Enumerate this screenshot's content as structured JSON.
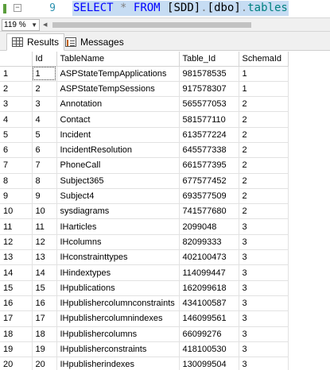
{
  "editor": {
    "line_number": "9",
    "code": {
      "select_kw": "SELECT",
      "star": "*",
      "from_kw": "FROM",
      "db": "[SDD]",
      "dot1": ".",
      "schema": "[dbo]",
      "dot2": ".",
      "table": "tables"
    }
  },
  "zoom": {
    "value": "119 %"
  },
  "tabs": [
    {
      "label": "Results",
      "icon": "grid-icon",
      "active": true
    },
    {
      "label": "Messages",
      "icon": "messages-icon",
      "active": false
    }
  ],
  "grid": {
    "columns": [
      "",
      "Id",
      "TableName",
      "Table_Id",
      "SchemaId"
    ],
    "rows": [
      [
        "1",
        "1",
        "ASPStateTempApplications",
        "981578535",
        "1"
      ],
      [
        "2",
        "2",
        "ASPStateTempSessions",
        "917578307",
        "1"
      ],
      [
        "3",
        "3",
        "Annotation",
        "565577053",
        "2"
      ],
      [
        "4",
        "4",
        "Contact",
        "581577110",
        "2"
      ],
      [
        "5",
        "5",
        "Incident",
        "613577224",
        "2"
      ],
      [
        "6",
        "6",
        "IncidentResolution",
        "645577338",
        "2"
      ],
      [
        "7",
        "7",
        "PhoneCall",
        "661577395",
        "2"
      ],
      [
        "8",
        "8",
        "Subject365",
        "677577452",
        "2"
      ],
      [
        "9",
        "9",
        "Subject4",
        "693577509",
        "2"
      ],
      [
        "10",
        "10",
        "sysdiagrams",
        "741577680",
        "2"
      ],
      [
        "11",
        "11",
        "IHarticles",
        "2099048",
        "3"
      ],
      [
        "12",
        "12",
        "IHcolumns",
        "82099333",
        "3"
      ],
      [
        "13",
        "13",
        "IHconstrainttypes",
        "402100473",
        "3"
      ],
      [
        "14",
        "14",
        "IHindextypes",
        "114099447",
        "3"
      ],
      [
        "15",
        "15",
        "IHpublications",
        "162099618",
        "3"
      ],
      [
        "16",
        "16",
        "IHpublishercolumnconstraints",
        "434100587",
        "3"
      ],
      [
        "17",
        "17",
        "IHpublishercolumnindexes",
        "146099561",
        "3"
      ],
      [
        "18",
        "18",
        "IHpublishercolumns",
        "66099276",
        "3"
      ],
      [
        "19",
        "19",
        "IHpublisherconstraints",
        "418100530",
        "3"
      ],
      [
        "20",
        "20",
        "IHpublisherindexes",
        "130099504",
        "3"
      ]
    ]
  }
}
